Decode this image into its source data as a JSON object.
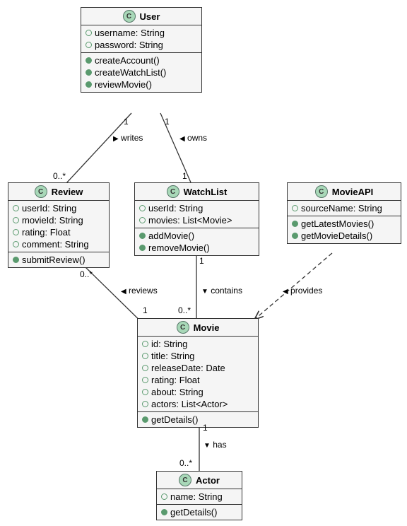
{
  "classes": {
    "User": {
      "name": "User",
      "attrs": [
        "username: String",
        "password: String"
      ],
      "ops": [
        "createAccount()",
        "createWatchList()",
        "reviewMovie()"
      ]
    },
    "Review": {
      "name": "Review",
      "attrs": [
        "userId: String",
        "movieId: String",
        "rating: Float",
        "comment: String"
      ],
      "ops": [
        "submitReview()"
      ]
    },
    "WatchList": {
      "name": "WatchList",
      "attrs": [
        "userId: String",
        "movies: List<Movie>"
      ],
      "ops": [
        "addMovie()",
        "removeMovie()"
      ]
    },
    "MovieAPI": {
      "name": "MovieAPI",
      "attrs": [
        "sourceName: String"
      ],
      "ops": [
        "getLatestMovies()",
        "getMovieDetails()"
      ]
    },
    "Movie": {
      "name": "Movie",
      "attrs": [
        "id: String",
        "title: String",
        "releaseDate: Date",
        "rating: Float",
        "about: String",
        "actors: List<Actor>"
      ],
      "ops": [
        "getDetails()"
      ]
    },
    "Actor": {
      "name": "Actor",
      "attrs": [
        "name: String"
      ],
      "ops": [
        "getDetails()"
      ]
    }
  },
  "labels": {
    "writes": "writes",
    "owns": "owns",
    "reviews": "reviews",
    "contains": "contains",
    "provides": "provides",
    "has": "has",
    "one": "1",
    "many": "0..*"
  }
}
